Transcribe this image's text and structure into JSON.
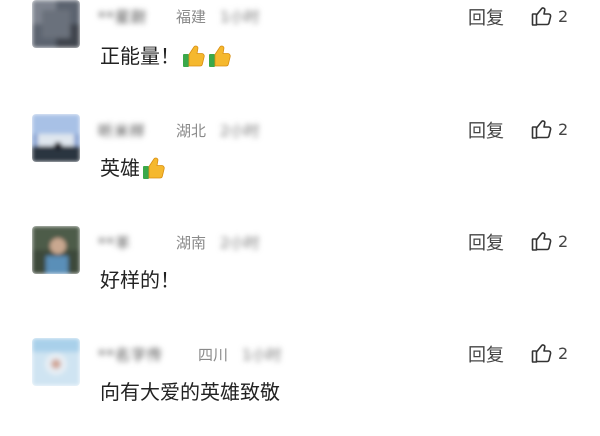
{
  "comments": [
    {
      "name": "**星尉",
      "region": "福建",
      "tail": "1小时",
      "reply_label": "回复",
      "likes": "2",
      "text": "正能量！",
      "emojis": [
        "thumbs-up",
        "thumbs-up"
      ]
    },
    {
      "name": "听米样",
      "region": "湖北",
      "tail": "2小时",
      "reply_label": "回复",
      "likes": "2",
      "text": "英雄",
      "emojis": [
        "thumbs-up"
      ]
    },
    {
      "name": "**羊",
      "region": "湖南",
      "tail": "2小时",
      "reply_label": "回复",
      "likes": "2",
      "text": "好样的！",
      "emojis": []
    },
    {
      "name": "**名字传",
      "region": "四川",
      "tail": "1小时",
      "reply_label": "回复",
      "likes": "2",
      "text": "向有大爱的英雄致敬",
      "emojis": []
    }
  ],
  "colors": {
    "text": "#222222",
    "region": "#8a8a8a",
    "action": "#444444",
    "emoji_yellow": "#f5b82e",
    "emoji_green": "#3aa84a"
  },
  "icons": {
    "like": "thumbs-up-outline-icon",
    "emoji": "thumbs-up-emoji"
  }
}
